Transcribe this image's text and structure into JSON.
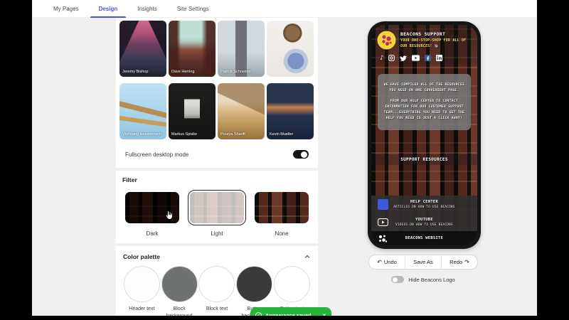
{
  "nav": {
    "items": [
      {
        "label": "My Pages"
      },
      {
        "label": "Design"
      },
      {
        "label": "Insights"
      },
      {
        "label": "Site Settings"
      }
    ]
  },
  "backgrounds": {
    "credits": [
      "Jeremy Bishop",
      "Dave Herring",
      "Patrick Schneider",
      "",
      "Wolfgang Hasselmann",
      "Markus Spiske",
      "Pourya Sharifi",
      "Kevin Mueller"
    ]
  },
  "fullscreen_toggle": {
    "label": "Fullscreen desktop mode",
    "on": true
  },
  "filter": {
    "heading": "Filter",
    "options": [
      {
        "label": "Dark",
        "selected": false
      },
      {
        "label": "Light",
        "selected": true
      },
      {
        "label": "None",
        "selected": false
      }
    ]
  },
  "color_palette": {
    "heading": "Color palette",
    "swatches": [
      {
        "label": "Header text",
        "color": "#fdfdfd"
      },
      {
        "label": "Block background",
        "color": "#6e736f"
      },
      {
        "label": "Block text",
        "color": "#ffffff"
      },
      {
        "label": "Button background",
        "color": "#3b3b3b"
      },
      {
        "label": "Button text",
        "color": "#ffffff"
      }
    ]
  },
  "preview": {
    "title": "BEACONS SUPPORT",
    "subtitle": "YOUR ONE-STOP-SHOP FOR ALL OF OUR RESOURCES! 📚",
    "paragraph1": "WE HAVE COMPILED ALL OF THE RESOURCES YOU NEED ON ONE CONVENIENT PAGE.",
    "paragraph2": "FROM OUR HELP CENTER TO CONTACT INFORMATION FOR OUR CUSTOMER SUPPORT TEAM...EVERYTHING YOU NEED TO GET THE HELP YOU NEED IS JUST A CLICK AWAY!",
    "section_title": "SUPPORT RESOURCES",
    "links": [
      {
        "title": "HELP CENTER",
        "subtitle": "ARTICLES ON HOW TO USE BEACONS"
      },
      {
        "title": "YOUTUBE",
        "subtitle": "VIDEOS ON HOW TO USE BEACONS"
      },
      {
        "title": "BEACONS WEBSITE",
        "subtitle": ""
      }
    ],
    "help_icon_color": "#3b5bdb"
  },
  "actions": {
    "undo": "Undo",
    "save_as": "Save As",
    "redo": "Redo"
  },
  "hide_logo_toggle": {
    "label": "Hide Beacons Logo",
    "on": false
  },
  "toast": {
    "message": "Appearance saved"
  },
  "colors": {
    "accent": "#4f55d2",
    "toast_green": "#27b53c"
  }
}
